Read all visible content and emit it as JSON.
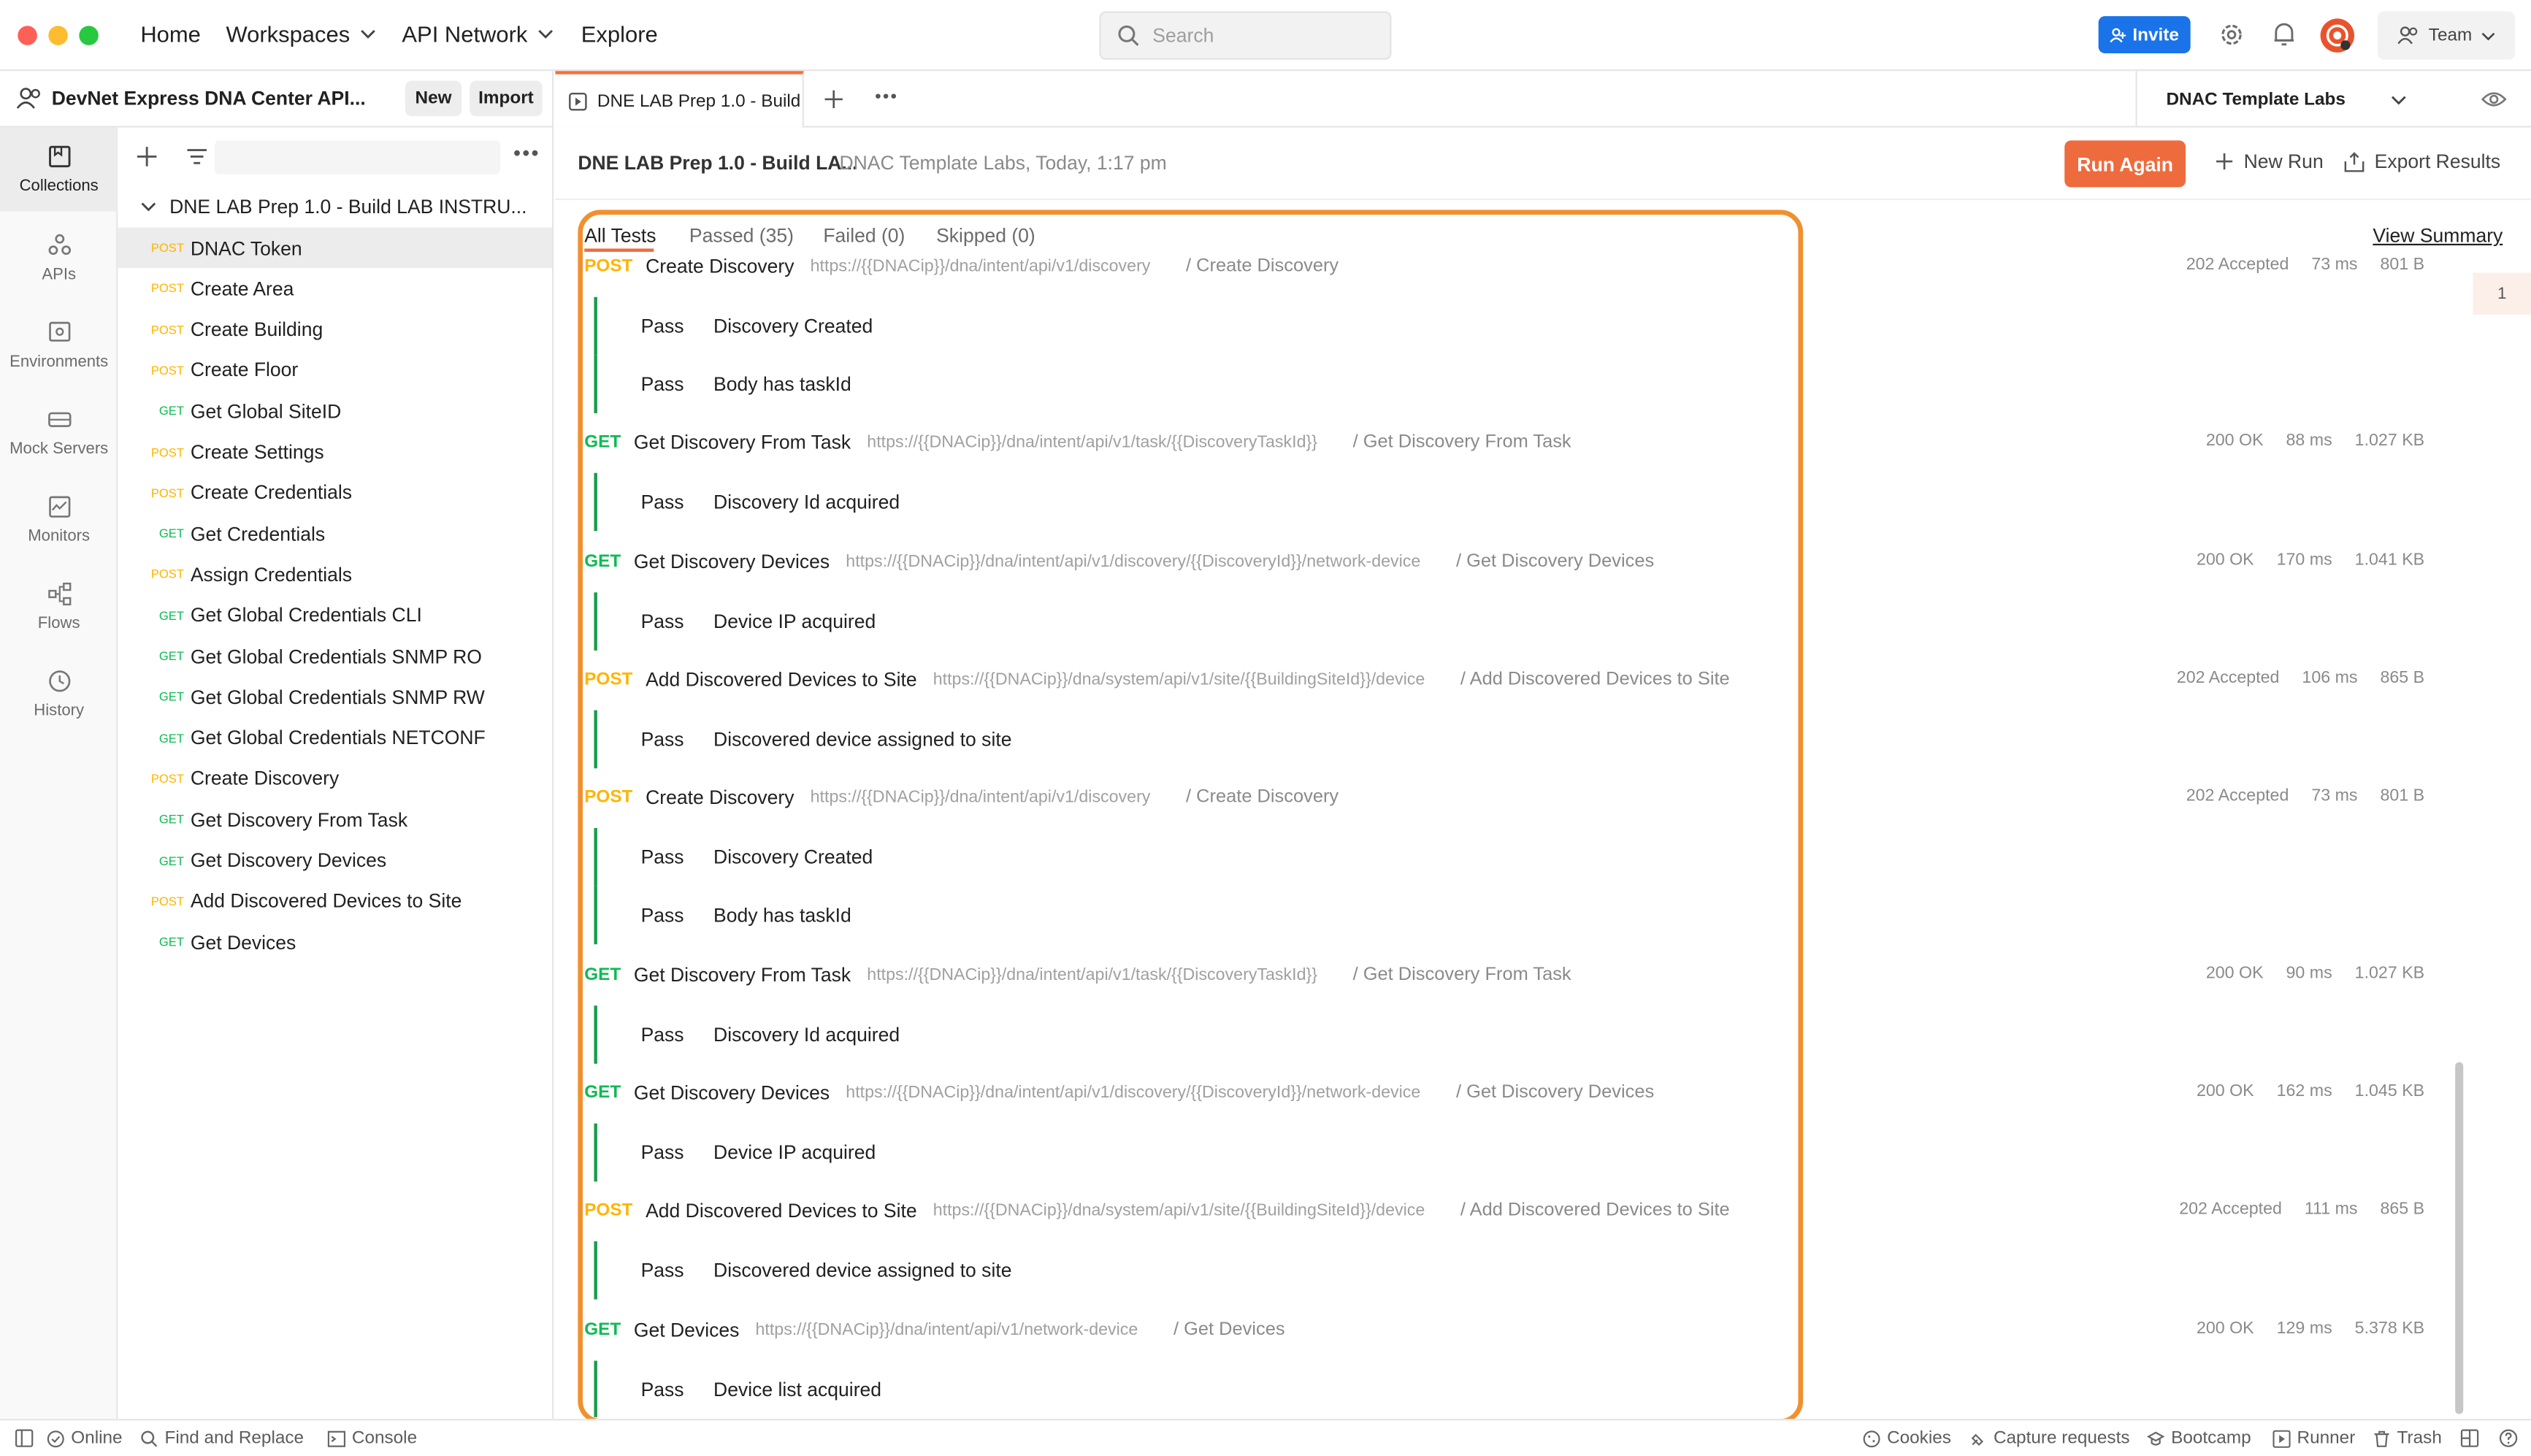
{
  "topnav": {
    "home": "Home",
    "workspaces": "Workspaces",
    "api_network": "API Network",
    "explore": "Explore",
    "search_placeholder": "Search",
    "invite": "Invite",
    "team": "Team"
  },
  "workspace": {
    "name": "DevNet Express DNA Center API...",
    "new_label": "New",
    "import_label": "Import"
  },
  "rail": [
    {
      "label": "Collections",
      "icon": "collections-icon"
    },
    {
      "label": "APIs",
      "icon": "apis-icon"
    },
    {
      "label": "Environments",
      "icon": "environments-icon"
    },
    {
      "label": "Mock Servers",
      "icon": "mock-servers-icon"
    },
    {
      "label": "Monitors",
      "icon": "monitors-icon"
    },
    {
      "label": "Flows",
      "icon": "flows-icon"
    },
    {
      "label": "History",
      "icon": "history-icon"
    }
  ],
  "collection": {
    "name": "DNE LAB Prep 1.0 - Build LAB INSTRU...",
    "requests": [
      {
        "method": "POST",
        "name": "DNAC Token"
      },
      {
        "method": "POST",
        "name": "Create Area"
      },
      {
        "method": "POST",
        "name": "Create Building"
      },
      {
        "method": "POST",
        "name": "Create Floor"
      },
      {
        "method": "GET",
        "name": "Get Global SiteID"
      },
      {
        "method": "POST",
        "name": "Create Settings"
      },
      {
        "method": "POST",
        "name": "Create Credentials"
      },
      {
        "method": "GET",
        "name": "Get Credentials"
      },
      {
        "method": "POST",
        "name": "Assign Credentials"
      },
      {
        "method": "GET",
        "name": "Get Global Credentials CLI"
      },
      {
        "method": "GET",
        "name": "Get Global Credentials SNMP RO"
      },
      {
        "method": "GET",
        "name": "Get Global Credentials SNMP RW"
      },
      {
        "method": "GET",
        "name": "Get Global Credentials NETCONF"
      },
      {
        "method": "POST",
        "name": "Create Discovery"
      },
      {
        "method": "GET",
        "name": "Get Discovery From Task"
      },
      {
        "method": "GET",
        "name": "Get Discovery Devices"
      },
      {
        "method": "POST",
        "name": "Add Discovered Devices to Site"
      },
      {
        "method": "GET",
        "name": "Get Devices"
      }
    ]
  },
  "tab": {
    "title": "DNE LAB Prep 1.0 - Build",
    "environment": "DNAC Template Labs"
  },
  "run": {
    "title": "DNE LAB Prep 1.0 - Build LA...",
    "meta": "DNAC Template Labs, Today, 1:17 pm",
    "run_again": "Run Again",
    "new_run": "New Run",
    "export": "Export Results",
    "view_summary": "View Summary",
    "filters": {
      "all": "All Tests",
      "passed": "Passed (35)",
      "failed": "Failed (0)",
      "skipped": "Skipped (0)"
    },
    "minimap_label": "1"
  },
  "results": {
    "partial_top": {
      "method": "POST",
      "name": "Create Discovery",
      "url": "https://{{DNACip}}/dna/intent/api/v1/discovery",
      "path": "/ Create Discovery",
      "status": "202 Accepted",
      "time": "73 ms",
      "size": "801 B"
    },
    "items": [
      {
        "type": "test",
        "status": "Pass",
        "name": "Discovery Created"
      },
      {
        "type": "test",
        "status": "Pass",
        "name": "Body has taskId"
      },
      {
        "type": "req",
        "method": "GET",
        "name": "Get Discovery From Task",
        "url": "https://{{DNACip}}/dna/intent/api/v1/task/{{DiscoveryTaskId}}",
        "path": "/ Get Discovery From Task",
        "status": "200 OK",
        "time": "88 ms",
        "size": "1.027 KB"
      },
      {
        "type": "test",
        "status": "Pass",
        "name": "Discovery Id acquired"
      },
      {
        "type": "req",
        "method": "GET",
        "name": "Get Discovery Devices",
        "url": "https://{{DNACip}}/dna/intent/api/v1/discovery/{{DiscoveryId}}/network-device",
        "path": "/ Get Discovery Devices",
        "status": "200 OK",
        "time": "170 ms",
        "size": "1.041 KB"
      },
      {
        "type": "test",
        "status": "Pass",
        "name": "Device IP acquired"
      },
      {
        "type": "req",
        "method": "POST",
        "name": "Add Discovered Devices to Site",
        "url": "https://{{DNACip}}/dna/system/api/v1/site/{{BuildingSiteId}}/device",
        "path": "/ Add Discovered Devices to Site",
        "status": "202 Accepted",
        "time": "106 ms",
        "size": "865 B"
      },
      {
        "type": "test",
        "status": "Pass",
        "name": "Discovered device assigned to site"
      },
      {
        "type": "req",
        "method": "POST",
        "name": "Create Discovery",
        "url": "https://{{DNACip}}/dna/intent/api/v1/discovery",
        "path": "/ Create Discovery",
        "status": "202 Accepted",
        "time": "73 ms",
        "size": "801 B"
      },
      {
        "type": "test",
        "status": "Pass",
        "name": "Discovery Created"
      },
      {
        "type": "test",
        "status": "Pass",
        "name": "Body has taskId"
      },
      {
        "type": "req",
        "method": "GET",
        "name": "Get Discovery From Task",
        "url": "https://{{DNACip}}/dna/intent/api/v1/task/{{DiscoveryTaskId}}",
        "path": "/ Get Discovery From Task",
        "status": "200 OK",
        "time": "90 ms",
        "size": "1.027 KB"
      },
      {
        "type": "test",
        "status": "Pass",
        "name": "Discovery Id acquired"
      },
      {
        "type": "req",
        "method": "GET",
        "name": "Get Discovery Devices",
        "url": "https://{{DNACip}}/dna/intent/api/v1/discovery/{{DiscoveryId}}/network-device",
        "path": "/ Get Discovery Devices",
        "status": "200 OK",
        "time": "162 ms",
        "size": "1.045 KB"
      },
      {
        "type": "test",
        "status": "Pass",
        "name": "Device IP acquired"
      },
      {
        "type": "req",
        "method": "POST",
        "name": "Add Discovered Devices to Site",
        "url": "https://{{DNACip}}/dna/system/api/v1/site/{{BuildingSiteId}}/device",
        "path": "/ Add Discovered Devices to Site",
        "status": "202 Accepted",
        "time": "111 ms",
        "size": "865 B"
      },
      {
        "type": "test",
        "status": "Pass",
        "name": "Discovered device assigned to site"
      },
      {
        "type": "req",
        "method": "GET",
        "name": "Get Devices",
        "url": "https://{{DNACip}}/dna/intent/api/v1/network-device",
        "path": "/ Get Devices",
        "status": "200 OK",
        "time": "129 ms",
        "size": "5.378 KB"
      },
      {
        "type": "test",
        "status": "Pass",
        "name": "Device list acquired"
      }
    ]
  },
  "statusbar": {
    "online": "Online",
    "find_replace": "Find and Replace",
    "console": "Console",
    "cookies": "Cookies",
    "capture": "Capture requests",
    "bootcamp": "Bootcamp",
    "runner": "Runner",
    "trash": "Trash"
  },
  "colors": {
    "accent": "#ee6b3e",
    "highlight_border": "#f0902e",
    "get": "#0cbb52",
    "post": "#ffb400",
    "invite": "#1a73e8",
    "pass_bar": "#1a9d4a"
  }
}
